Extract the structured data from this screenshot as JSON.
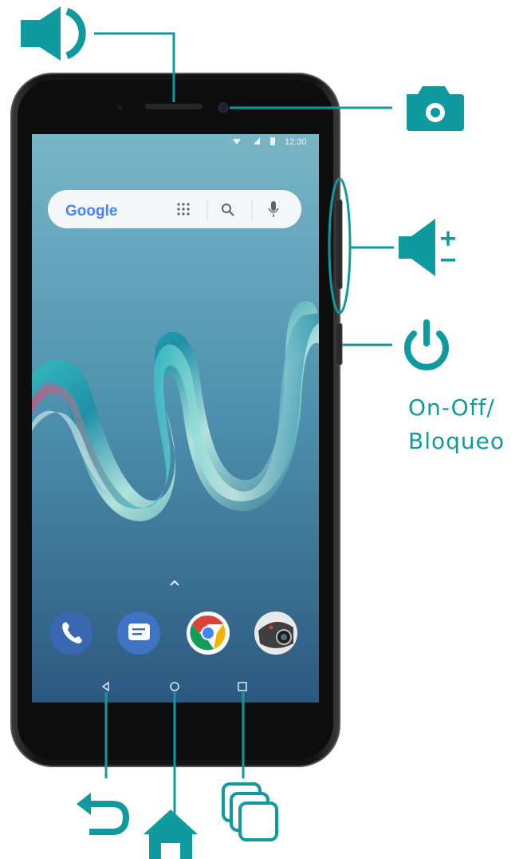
{
  "phone": {
    "status_time": "12:30",
    "search_brand": "Google"
  },
  "labels": {
    "power_line1": "On-Off/",
    "power_line2": "Bloqueo"
  },
  "callouts": [
    {
      "name": "earpiece",
      "icon": "speaker-icon"
    },
    {
      "name": "front-camera",
      "icon": "camera-icon"
    },
    {
      "name": "volume-buttons",
      "icon": "volume-plus-minus-icon"
    },
    {
      "name": "power-button",
      "icon": "power-icon"
    },
    {
      "name": "back-key",
      "icon": "back-arrow-icon"
    },
    {
      "name": "home-key",
      "icon": "home-icon"
    },
    {
      "name": "recent-apps-key",
      "icon": "recent-apps-icon"
    }
  ],
  "dock_apps": [
    "phone-app-icon",
    "messages-app-icon",
    "chrome-app-icon",
    "camera-app-icon"
  ],
  "colors": {
    "accent": "#0f9aa0",
    "phone_body": "#1a1a1a",
    "screen_top": "#6fb0c4",
    "screen_bottom": "#2f5e86"
  }
}
